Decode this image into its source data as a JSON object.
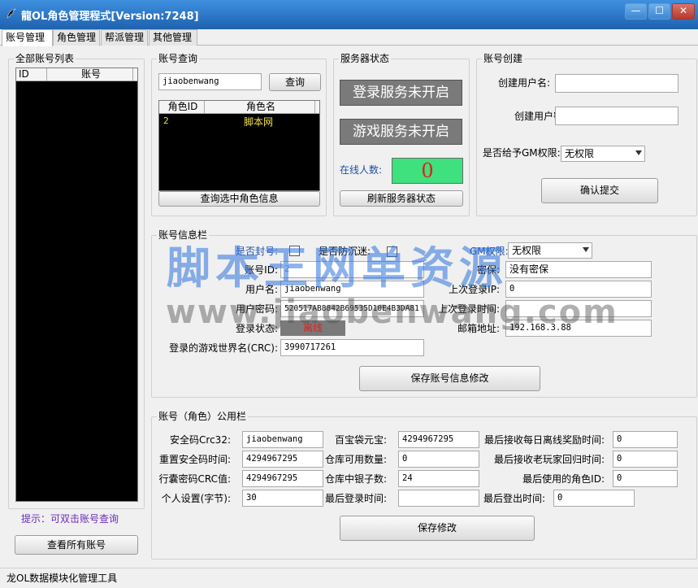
{
  "window": {
    "title": "龍OL角色管理程式[Version:7248]",
    "icon": "dragon-icon",
    "minimize": "—",
    "maximize": "☐",
    "close": "✕"
  },
  "tabs": [
    "账号管理",
    "角色管理",
    "帮派管理",
    "其他管理"
  ],
  "account_list": {
    "title": "全部账号列表",
    "columns": [
      "ID",
      "账号"
    ],
    "hint": "提示：可双击账号查询",
    "view_all_button": "查看所有账号"
  },
  "account_query": {
    "title": "账号查询",
    "input_value": "jiaobenwang",
    "query_button": "查询",
    "columns": [
      "角色ID",
      "角色名"
    ],
    "rows": [
      {
        "id": "2",
        "name": "脚本网"
      }
    ],
    "query_role_button": "查询选中角色信息"
  },
  "server_status": {
    "title": "服务器状态",
    "login_service": "登录服务未开启",
    "game_service": "游戏服务未开启",
    "online_label": "在线人数:",
    "online_count": "0",
    "refresh_button": "刷新服务器状态"
  },
  "account_create": {
    "title": "账号创建",
    "username_label": "创建用户名:",
    "password_label": "创建用户密码:",
    "gm_label": "是否给予GM权限:",
    "gm_value": "无权限",
    "submit_button": "确认提交"
  },
  "account_info": {
    "title": "账号信息栏",
    "banned_label": "是否封号:",
    "anti_addiction_label": "是否防沉迷:",
    "gm_label": "GM权限:",
    "gm_value": "无权限",
    "account_id_label": "账号ID:",
    "account_id_value": "2",
    "username_label": "用户名:",
    "username_value": "jiaobenwang",
    "password_label": "用户密码:",
    "password_value": "520517AB8842B69535D10E4B3DA81",
    "login_status_label": "登录状态:",
    "login_status_value": "离线",
    "world_label": "登录的游戏世界名(CRC):",
    "world_value": "3990717261",
    "secret_label": "密保:",
    "secret_value": "没有密保",
    "last_ip_label": "上次登录IP:",
    "last_ip_value": "0",
    "last_login_time_label": "上次登录时间:",
    "last_login_time_value": "",
    "email_label": "邮箱地址:",
    "email_value": "192.168.3.88",
    "save_button": "保存账号信息修改"
  },
  "public_info": {
    "title": "账号（角色）公用栏",
    "safe_code_label": "安全码Crc32:",
    "safe_code_value": "jiaobenwang",
    "reset_safe_time_label": "重置安全码时间:",
    "reset_safe_time_value": "4294967295",
    "bag_pwd_label": "行囊密码CRC值:",
    "bag_pwd_value": "4294967295",
    "personal_label": "个人设置(字节):",
    "personal_value": "30",
    "yuanbao_label": "百宝袋元宝:",
    "yuanbao_value": "4294967295",
    "warehouse_label": "仓库可用数量:",
    "warehouse_value": "0",
    "silver_label": "仓库中银子数:",
    "silver_value": "24",
    "last_login_label": "最后登录时间:",
    "last_login_value": "",
    "offline_reward_label": "最后接收每日离线奖励时间:",
    "offline_reward_value": "0",
    "veteran_label": "最后接收老玩家回归时间:",
    "veteran_value": "0",
    "last_role_label": "最后使用的角色ID:",
    "last_role_value": "0",
    "last_logout_label": "最后登出时间:",
    "last_logout_value": "0",
    "save_button": "保存修改"
  },
  "watermark": {
    "line1": "脚本王网单资源",
    "line2": "www.jiaobenwang.com"
  },
  "statusbar": {
    "text": "龙OL数据模块化管理工具"
  }
}
